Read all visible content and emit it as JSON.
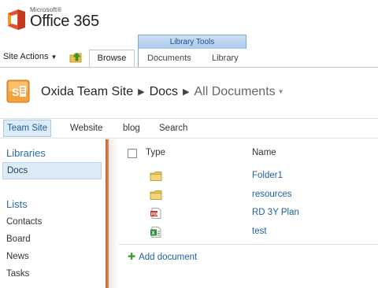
{
  "brand": {
    "company": "Microsoft®",
    "product": "Office 365"
  },
  "ribbon": {
    "site_actions": "Site Actions",
    "browse_tab": "Browse",
    "contextual_group": "Library Tools",
    "contextual_tabs": [
      "Documents",
      "Library"
    ]
  },
  "breadcrumb": {
    "site": "Oxida Team Site",
    "library": "Docs",
    "view": "All Documents"
  },
  "topnav": [
    "Team Site",
    "Website",
    "blog",
    "Search"
  ],
  "quicklaunch": {
    "libraries_heading": "Libraries",
    "libraries": [
      "Docs"
    ],
    "lists_heading": "Lists",
    "lists": [
      "Contacts",
      "Board",
      "News",
      "Tasks"
    ]
  },
  "doclist": {
    "columns": {
      "type": "Type",
      "name": "Name"
    },
    "rows": [
      {
        "type_icon": "folder-icon",
        "name": "Folder1"
      },
      {
        "type_icon": "folder-icon",
        "name": "resources"
      },
      {
        "type_icon": "pdf-document-icon",
        "name": "RD 3Y Plan"
      },
      {
        "type_icon": "excel-document-icon",
        "name": "test"
      }
    ],
    "add_document": "Add document"
  },
  "colors": {
    "accent_blue": "#2d6ba8",
    "link_blue": "#1f5f9c",
    "quicklaunch_bar": "#c4623a",
    "office_logo_red": "#e4502a",
    "office_logo_orange": "#f29b22"
  }
}
